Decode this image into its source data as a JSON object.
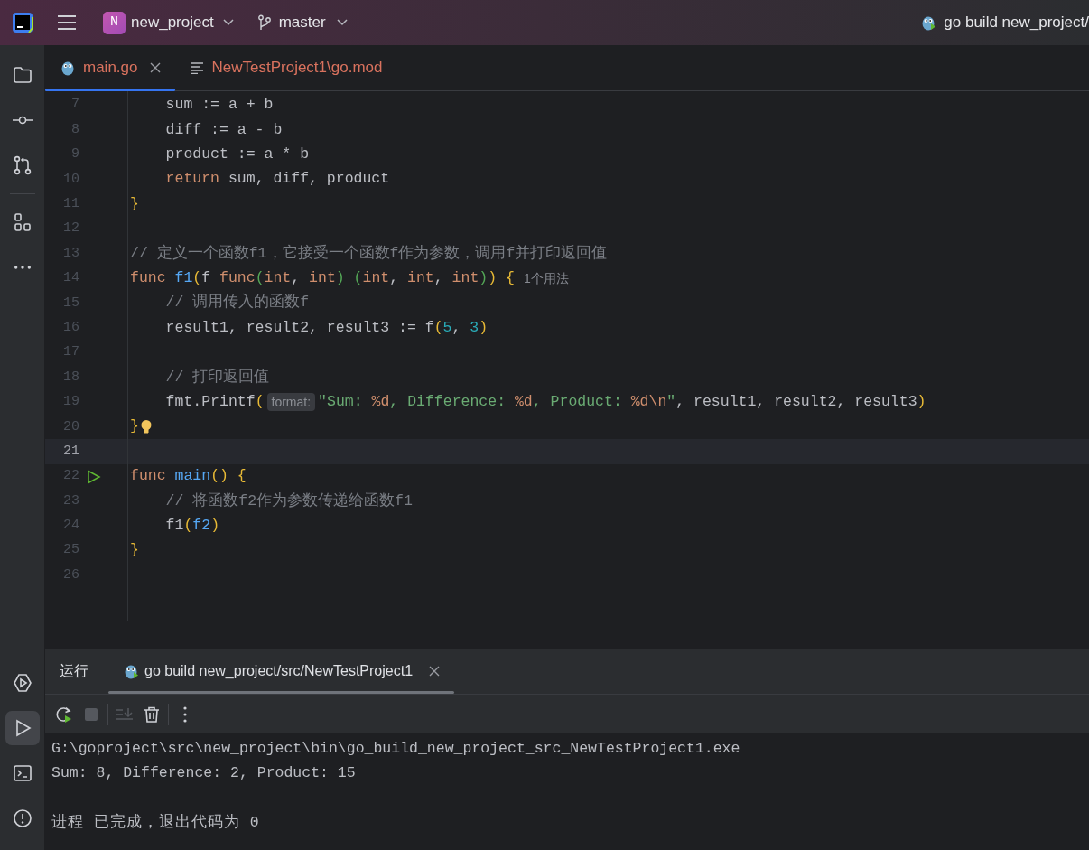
{
  "title_bar": {
    "project_badge": "N",
    "project": "new_project",
    "branch": "master",
    "run_config": "go build new_project/"
  },
  "sidebar": {
    "top": [
      {
        "selected": false
      },
      {
        "selected": false
      },
      {
        "selected": false
      },
      {
        "selected": false
      },
      {
        "selected": false
      }
    ],
    "bottom": [
      {
        "selected": false
      },
      {
        "selected": true
      },
      {
        "selected": false
      },
      {
        "selected": false
      }
    ]
  },
  "editor_tabs": [
    {
      "label": "main.go",
      "selected": true,
      "has_errors": true,
      "closable": true
    },
    {
      "label": "NewTestProject1\\go.mod",
      "selected": false,
      "has_errors": true,
      "closable": false
    }
  ],
  "code_lines": [
    {
      "number": "7",
      "tokens": [
        {
          "t": "    sum := a + b",
          "kind": "plain"
        }
      ]
    },
    {
      "number": "8",
      "tokens": [
        {
          "t": "    diff := a - b",
          "kind": "plain"
        }
      ]
    },
    {
      "number": "9",
      "tokens": [
        {
          "t": "    product := a * b",
          "kind": "plain"
        }
      ]
    },
    {
      "number": "10",
      "tokens": [
        {
          "t": "    return",
          "kind": "kw"
        },
        {
          "t": " sum, diff, product",
          "kind": "plain"
        }
      ]
    },
    {
      "number": "11",
      "tokens": [
        {
          "t": "}",
          "kind": "p1"
        }
      ]
    },
    {
      "number": "12"
    },
    {
      "number": "13",
      "tokens": [
        {
          "t": "// 定义一个函数f1，它接受一个函数f作为参数，调用f并打印返回值",
          "kind": "comment"
        }
      ]
    },
    {
      "number": "14",
      "tokens": [
        {
          "t": "func",
          "kind": "kw"
        },
        {
          "t": " f1",
          "kind": "fn"
        },
        {
          "t": "(",
          "kind": "p1"
        },
        {
          "t": "f ",
          "kind": "plain"
        },
        {
          "t": "func",
          "kind": "kw"
        },
        {
          "t": "(",
          "kind": "p2"
        },
        {
          "t": "int",
          "kind": "kw"
        },
        {
          "t": ", ",
          "kind": "plain"
        },
        {
          "t": "int",
          "kind": "kw"
        },
        {
          "t": ")",
          "kind": "p2"
        },
        {
          "t": " (",
          "kind": "p2"
        },
        {
          "t": "int",
          "kind": "kw"
        },
        {
          "t": ", ",
          "kind": "plain"
        },
        {
          "t": "int",
          "kind": "kw"
        },
        {
          "t": ", ",
          "kind": "plain"
        },
        {
          "t": "int",
          "kind": "kw"
        },
        {
          "t": ")",
          "kind": "p2"
        },
        {
          "t": ")",
          "kind": "p1"
        },
        {
          "t": " {",
          "kind": "p1"
        },
        {
          "t": "1个用法",
          "kind": "usage"
        }
      ]
    },
    {
      "number": "15",
      "tokens": [
        {
          "t": "    // 调用传入的函数f",
          "kind": "comment"
        }
      ]
    },
    {
      "number": "16",
      "tokens": [
        {
          "t": "    result1, result2, result3 := f",
          "kind": "plain"
        },
        {
          "t": "(",
          "kind": "p1"
        },
        {
          "t": "5",
          "kind": "num"
        },
        {
          "t": ", ",
          "kind": "plain"
        },
        {
          "t": "3",
          "kind": "num"
        },
        {
          "t": ")",
          "kind": "p1"
        }
      ]
    },
    {
      "number": "17"
    },
    {
      "number": "18",
      "tokens": [
        {
          "t": "    // 打印返回值",
          "kind": "comment"
        }
      ]
    },
    {
      "number": "19",
      "tokens": [
        {
          "t": "    fmt.Printf",
          "kind": "plain"
        },
        {
          "t": "(",
          "kind": "p1"
        },
        {
          "t": "format:",
          "kind": "inlay"
        },
        {
          "t": "\"Sum: ",
          "kind": "str"
        },
        {
          "t": "%d",
          "kind": "fmt"
        },
        {
          "t": ", Difference: ",
          "kind": "str"
        },
        {
          "t": "%d",
          "kind": "fmt"
        },
        {
          "t": ", Product: ",
          "kind": "str"
        },
        {
          "t": "%d\\n",
          "kind": "fmt"
        },
        {
          "t": "\"",
          "kind": "str"
        },
        {
          "t": ", result1, result2, result3",
          "kind": "plain"
        },
        {
          "t": ")",
          "kind": "p1"
        }
      ]
    },
    {
      "number": "20",
      "tokens": [
        {
          "t": "}",
          "kind": "p1"
        }
      ],
      "bulb": true
    },
    {
      "number": "21",
      "current": true
    },
    {
      "number": "22",
      "tokens": [
        {
          "t": "func",
          "kind": "kw"
        },
        {
          "t": " main",
          "kind": "fn"
        },
        {
          "t": "()",
          "kind": "p1"
        },
        {
          "t": " {",
          "kind": "p1"
        }
      ],
      "runnable": true
    },
    {
      "number": "23",
      "tokens": [
        {
          "t": "    // 将函数f2作为参数传递给函数f1",
          "kind": "comment"
        }
      ]
    },
    {
      "number": "24",
      "tokens": [
        {
          "t": "    f1",
          "kind": "plain"
        },
        {
          "t": "(",
          "kind": "p1"
        },
        {
          "t": "f2",
          "kind": "fn"
        },
        {
          "t": ")",
          "kind": "p1"
        }
      ]
    },
    {
      "number": "25",
      "tokens": [
        {
          "t": "}",
          "kind": "p1"
        }
      ]
    },
    {
      "number": "26"
    }
  ],
  "run_panel": {
    "title": "运行",
    "tab": {
      "label": "go build new_project/src/NewTestProject1",
      "selected": true
    },
    "toolbar": [
      {
        "disabled": false
      },
      {
        "disabled": true
      },
      {
        "disabled": true
      },
      {
        "disabled": false
      },
      {
        "disabled": false
      }
    ],
    "console": [
      {
        "text": "G:\\goproject\\src\\new_project\\bin\\go_build_new_project_src_NewTestProject1.exe",
        "kind": "output"
      },
      {
        "text": "Sum: 8, Difference: 2, Product: 15",
        "kind": "output"
      },
      {
        "text": "进程 已完成，退出代码为 0",
        "kind": "exit"
      }
    ]
  }
}
